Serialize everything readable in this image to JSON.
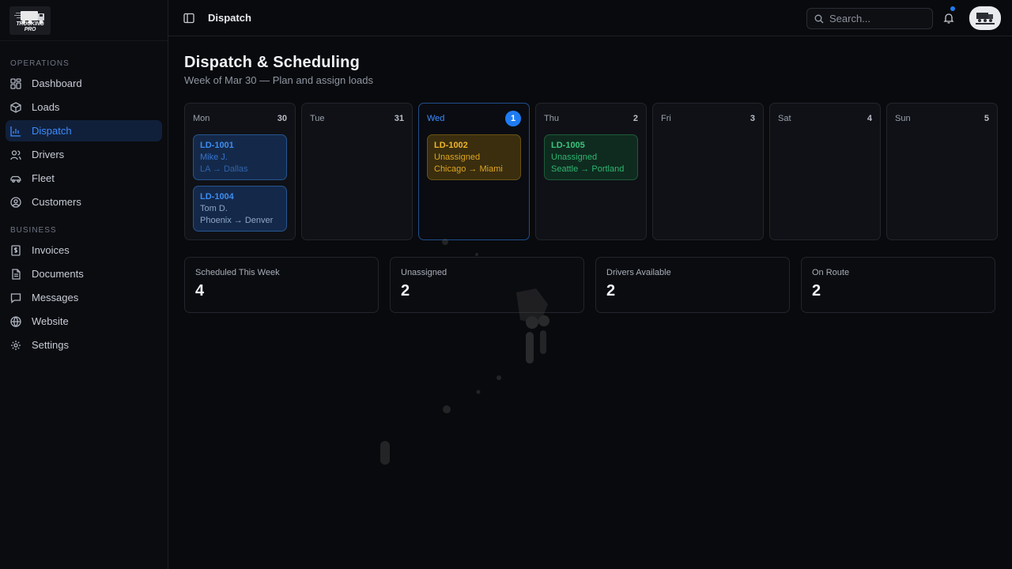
{
  "brand": {
    "name": "TRUCKING PRO"
  },
  "sidebar": {
    "sections": [
      {
        "title": "OPERATIONS"
      },
      {
        "title": "BUSINESS"
      }
    ],
    "operations": [
      {
        "label": "Dashboard",
        "icon": "dashboard-icon"
      },
      {
        "label": "Loads",
        "icon": "box-icon"
      },
      {
        "label": "Dispatch",
        "icon": "bar-chart-icon",
        "active": true
      },
      {
        "label": "Drivers",
        "icon": "users-icon"
      },
      {
        "label": "Fleet",
        "icon": "car-icon"
      },
      {
        "label": "Customers",
        "icon": "user-circle-icon"
      }
    ],
    "business": [
      {
        "label": "Invoices",
        "icon": "receipt-icon"
      },
      {
        "label": "Documents",
        "icon": "file-icon"
      },
      {
        "label": "Messages",
        "icon": "message-icon"
      },
      {
        "label": "Website",
        "icon": "globe-icon"
      },
      {
        "label": "Settings",
        "icon": "gear-icon"
      }
    ]
  },
  "topbar": {
    "title": "Dispatch",
    "search_placeholder": "Search...",
    "has_notification": true
  },
  "page": {
    "title": "Dispatch & Scheduling",
    "subtitle": "Week of Mar 30 — Plan and assign loads"
  },
  "week": [
    {
      "day": "Mon",
      "date": "30",
      "loads": [
        {
          "id": "LD-1001",
          "driver": "Mike J.",
          "route": "LA → Dallas",
          "status": "assigned"
        },
        {
          "id": "LD-1004",
          "driver": "Tom D.",
          "route": "Phoenix → Denver",
          "status": "assigned"
        }
      ]
    },
    {
      "day": "Tue",
      "date": "31",
      "loads": []
    },
    {
      "day": "Wed",
      "date": "1",
      "today": true,
      "loads": [
        {
          "id": "LD-1002",
          "driver": "Unassigned",
          "route": "Chicago → Miami",
          "status": "unassigned"
        }
      ]
    },
    {
      "day": "Thu",
      "date": "2",
      "loads": [
        {
          "id": "LD-1005",
          "driver": "Unassigned",
          "route": "Seattle → Portland",
          "status": "scheduled"
        }
      ]
    },
    {
      "day": "Fri",
      "date": "3",
      "loads": []
    },
    {
      "day": "Sat",
      "date": "4",
      "loads": []
    },
    {
      "day": "Sun",
      "date": "5",
      "loads": []
    }
  ],
  "stats": [
    {
      "label": "Scheduled This Week",
      "value": "4"
    },
    {
      "label": "Unassigned",
      "value": "2"
    },
    {
      "label": "Drivers Available",
      "value": "2"
    },
    {
      "label": "On Route",
      "value": "2"
    }
  ],
  "colors": {
    "accent": "#1f7bf2",
    "assigned": "#3d8cf0",
    "unassigned": "#f0b52b",
    "scheduled": "#3bc47d"
  }
}
